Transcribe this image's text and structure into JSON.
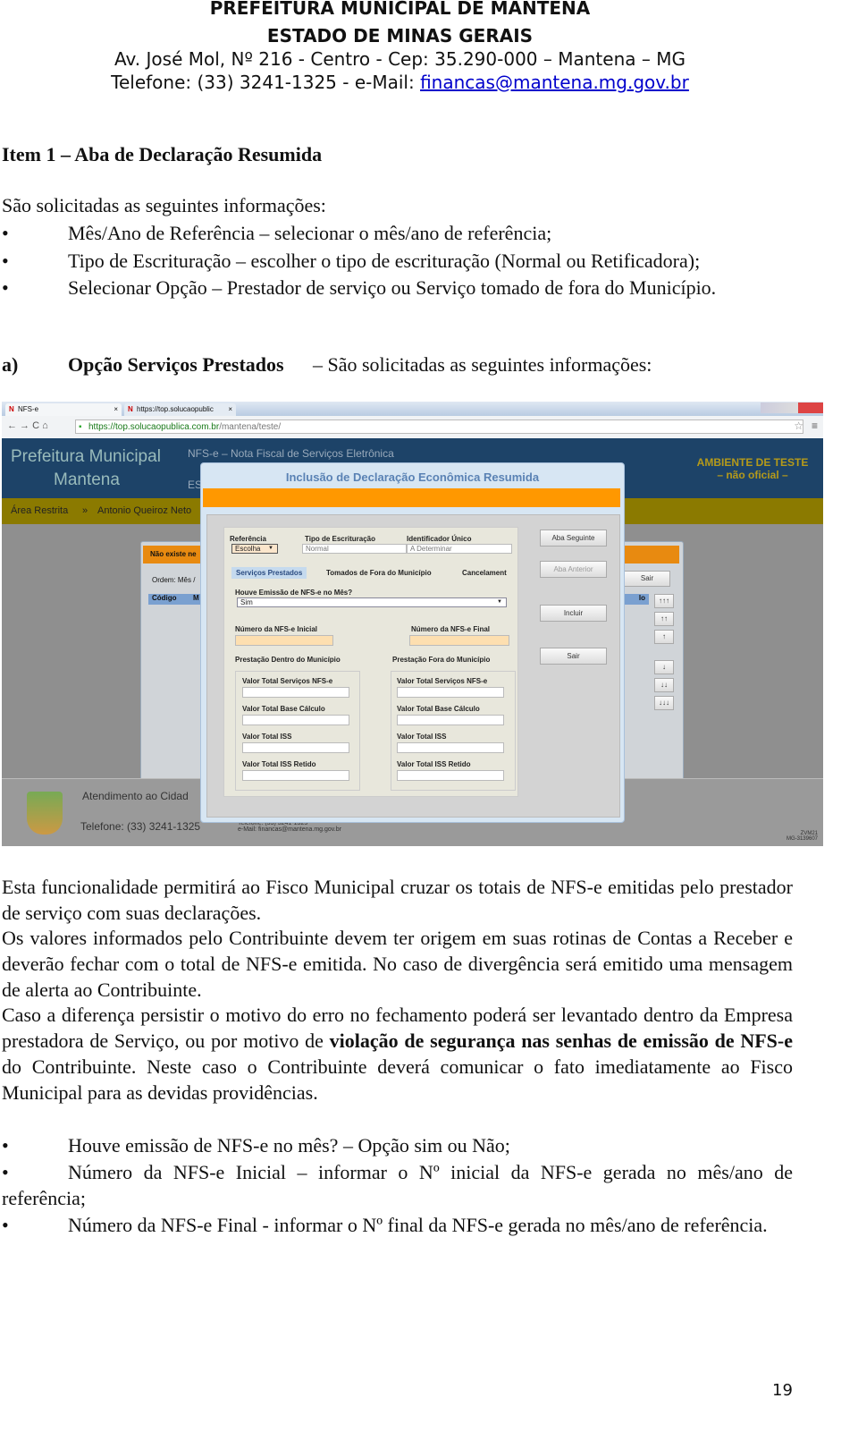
{
  "header": {
    "line1": "PREFEITURA MUNICIPAL DE MANTENA",
    "line2": "ESTADO DE MINAS GERAIS",
    "line3": "Av. José Mol, Nº 216 - Centro - Cep: 35.290-000 – Mantena – MG",
    "line4_prefix": "Telefone: (33) 3241-1325 - e-Mail: ",
    "email": "financas@mantena.mg.gov.br"
  },
  "title": "Item 1 – Aba de Declaração Resumida",
  "intro": "São solicitadas as seguintes informações:",
  "bullets1": [
    "Mês/Ano de Referência – selecionar o mês/ano de referência;",
    "Tipo de Escrituração – escolher o tipo de escrituração (Normal ou Retificadora);",
    "Selecionar Opção – Prestador de serviço ou Serviço tomado de fora do Município."
  ],
  "section_a": {
    "marker": "a)",
    "bold": "Opção Serviços Prestados",
    "rest": " – São solicitadas as seguintes informações:"
  },
  "screenshot": {
    "tabs": [
      "NFS-e",
      "https://top.solucaopublic"
    ],
    "url_host": "https://top.solucaopublica.com.br",
    "url_path": "/mantena/teste/",
    "brand1": "Prefeitura Municipal",
    "brand2": "Mantena",
    "system": "NFS-e – Nota Fiscal de Serviços Eletrônica",
    "system2": "ES",
    "env1": "AMBIENTE DE TESTE",
    "env2": "– não oficial –",
    "breadcrumb": [
      "Área Restrita",
      "»",
      "Antonio Queiroz Neto"
    ],
    "bg_alert": "Não existe ne",
    "bg_order": "Ordem: Mês /",
    "bg_cols": [
      "Código",
      "M"
    ],
    "bg_col_right": "lo",
    "bg_exit": "Sair",
    "arrows": [
      "↑↑↑",
      "↑↑",
      "↑",
      "↓",
      "↓↓",
      "↓↓↓"
    ],
    "footer_title": "Atendimento ao Cidad",
    "footer_phone": "Telefone: (33) 3241-1325",
    "footer_small1": "Telefone: (33) 3241-1325",
    "footer_small2": "e-Mail: financas@mantena.mg.gov.br",
    "footer_code1": "ZVM21",
    "footer_code2": "MG-3139607",
    "modal": {
      "title": "Inclusão de Declaração Econômica Resumida",
      "ref_label": "Referência",
      "ref_value": "Escolha",
      "tipo_label": "Tipo de Escrituração",
      "tipo_value": "Normal",
      "id_label": "Identificador Único",
      "id_value": "A Determinar",
      "tabs": [
        "Serviços Prestados",
        "Tomados de Fora do Município",
        "Cancelament"
      ],
      "emissao_label": "Houve Emissão de NFS-e no Mês?",
      "emissao_value": "Sim",
      "inicial_label": "Número da NFS-e Inicial",
      "final_label": "Número da NFS-e Final",
      "dentro": "Prestação Dentro do Município",
      "fora": "Prestação Fora do Município",
      "fields": [
        "Valor Total Serviços NFS-e",
        "Valor Total Base Cálculo",
        "Valor Total ISS",
        "Valor Total ISS Retido"
      ],
      "buttons": [
        "Aba Seguinte",
        "Aba Anterior",
        "Incluir",
        "Sair"
      ]
    }
  },
  "para1": "Esta funcionalidade permitirá ao Fisco Municipal cruzar os totais de NFS-e emitidas pelo prestador de serviço com suas declarações.",
  "para2": "Os valores informados pelo Contribuinte devem ter origem em suas rotinas de Contas a Receber e deverão fechar com o total de NFS-e emitida. No caso de divergência será emitido uma mensagem de alerta ao Contribuinte.",
  "para3": {
    "a": "Caso a diferença persistir o motivo do erro no fechamento poderá ser levantado dentro da Empresa prestadora de Serviço, ou por motivo de ",
    "bold": "violação de segurança nas senhas de emissão de NFS-e",
    "b": " do Contribuinte. Neste caso o Contribuinte deverá comunicar o fato imediatamente ao Fisco Municipal para as devidas providências."
  },
  "bullets2": [
    "Houve emissão de NFS-e no mês? – Opção sim ou Não;",
    "Número da NFS-e Inicial – informar o Nº inicial da NFS-e gerada no mês/ano de referência;",
    "Número da NFS-e Final - informar o Nº final da NFS-e gerada no mês/ano de referência."
  ],
  "bullet_char": "•",
  "page_number": "19"
}
